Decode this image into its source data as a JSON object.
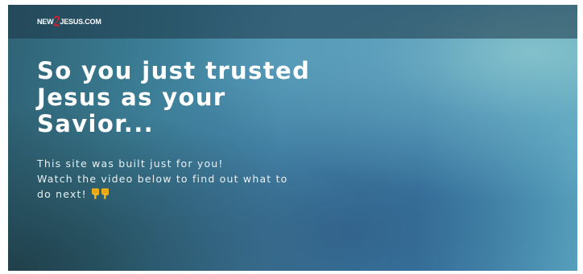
{
  "header": {
    "logo_prefix": "NEW",
    "logo_suffix": "JESUS.COM",
    "logo_mark_icon": "red-numeral-2-icon"
  },
  "hero": {
    "title": "So you just trusted Jesus as your Savior...",
    "line1": "This site was built just for you!",
    "line2": "Watch the video below to find out what to",
    "line3": "do next!",
    "pointer_icons": [
      "pointing-down-hand-icon",
      "pointing-down-hand-icon"
    ]
  },
  "colors": {
    "logo_accent": "#d81f26",
    "text": "#ffffff",
    "pointer": "#f2b21a"
  }
}
